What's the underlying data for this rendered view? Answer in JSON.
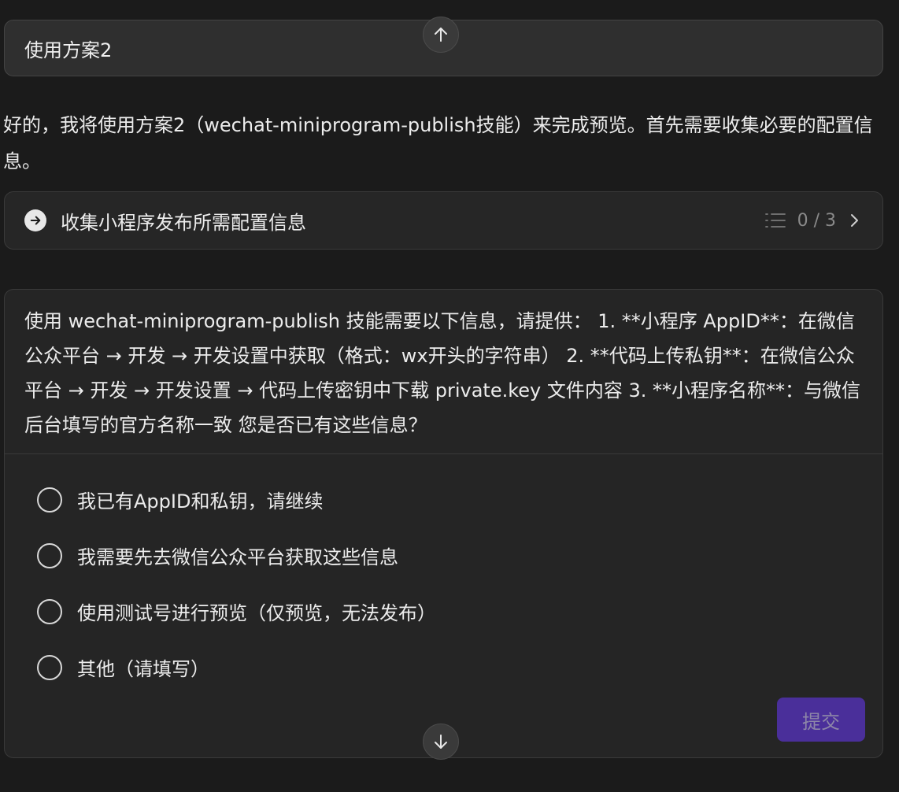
{
  "user_message": "使用方案2",
  "assistant_text": "好的，我将使用方案2（wechat-miniprogram-publish技能）来完成预览。首先需要收集必要的配置信息。",
  "task": {
    "title": "收集小程序发布所需配置信息",
    "progress": "0 / 3",
    "icons": [
      "arrow-right-circle-icon",
      "list-icon",
      "chevron-right-icon"
    ]
  },
  "question": {
    "text": "使用 wechat-miniprogram-publish 技能需要以下信息，请提供： 1. **小程序 AppID**：在微信公众平台 → 开发 → 开发设置中获取（格式：wx开头的字符串） 2. **代码上传私钥**：在微信公众平台 → 开发 → 开发设置 → 代码上传密钥中下载 private.key 文件内容 3. **小程序名称**：与微信后台填写的官方名称一致 您是否已有这些信息？",
    "options": [
      "我已有AppID和私钥，请继续",
      "我需要先去微信公众平台获取这些信息",
      "使用测试号进行预览（仅预览，无法发布）",
      "其他（请填写）"
    ],
    "submit_label": "提交"
  },
  "colors": {
    "background": "#1b1b1b",
    "card": "#252525",
    "submit_bg": "#4a2f9a"
  }
}
